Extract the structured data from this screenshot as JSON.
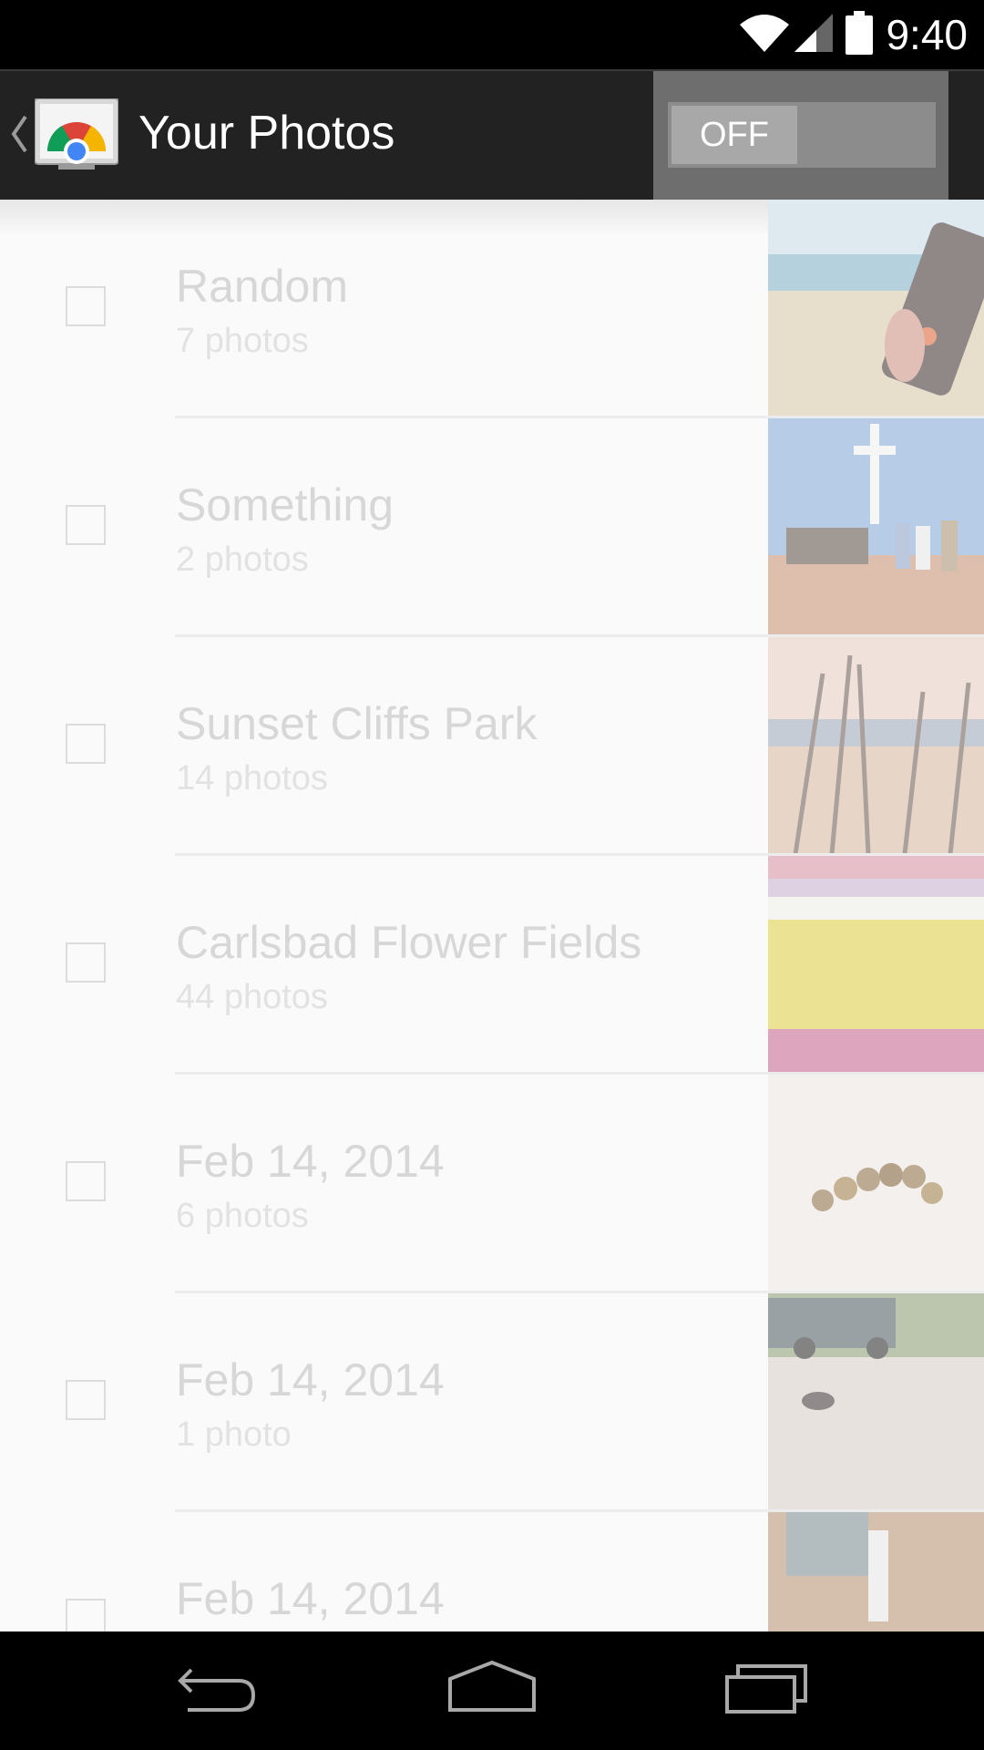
{
  "status_bar": {
    "time": "9:40",
    "icons": [
      "wifi-icon",
      "signal-icon",
      "battery-icon"
    ]
  },
  "action_bar": {
    "title": "Your Photos",
    "app_icon": "chromecast-photos-icon",
    "toggle_label": "OFF"
  },
  "albums": [
    {
      "title": "Random",
      "count": "7 photos",
      "checked": false,
      "thumb": "beach-phone"
    },
    {
      "title": "Something",
      "count": "2 photos",
      "checked": false,
      "thumb": "cross-memorial"
    },
    {
      "title": "Sunset Cliffs Park",
      "count": "14 photos",
      "checked": false,
      "thumb": "sunset-grass"
    },
    {
      "title": "Carlsbad Flower Fields",
      "count": "44 photos",
      "checked": false,
      "thumb": "flower-fields"
    },
    {
      "title": "Feb 14, 2014",
      "count": "6 photos",
      "checked": false,
      "thumb": "coins"
    },
    {
      "title": "Feb 14, 2014",
      "count": "1 photo",
      "checked": false,
      "thumb": "truck-road"
    },
    {
      "title": "Feb 14, 2014",
      "count": "",
      "checked": false,
      "thumb": "brick-wall"
    }
  ],
  "nav_bar": {
    "buttons": [
      "back-icon",
      "home-icon",
      "recents-icon"
    ]
  },
  "colors": {
    "action_bar": "#222222",
    "toggle_bg": "#6e6e6e",
    "list_bg": "#fafafa",
    "text_faded": "#d7d7d7"
  }
}
